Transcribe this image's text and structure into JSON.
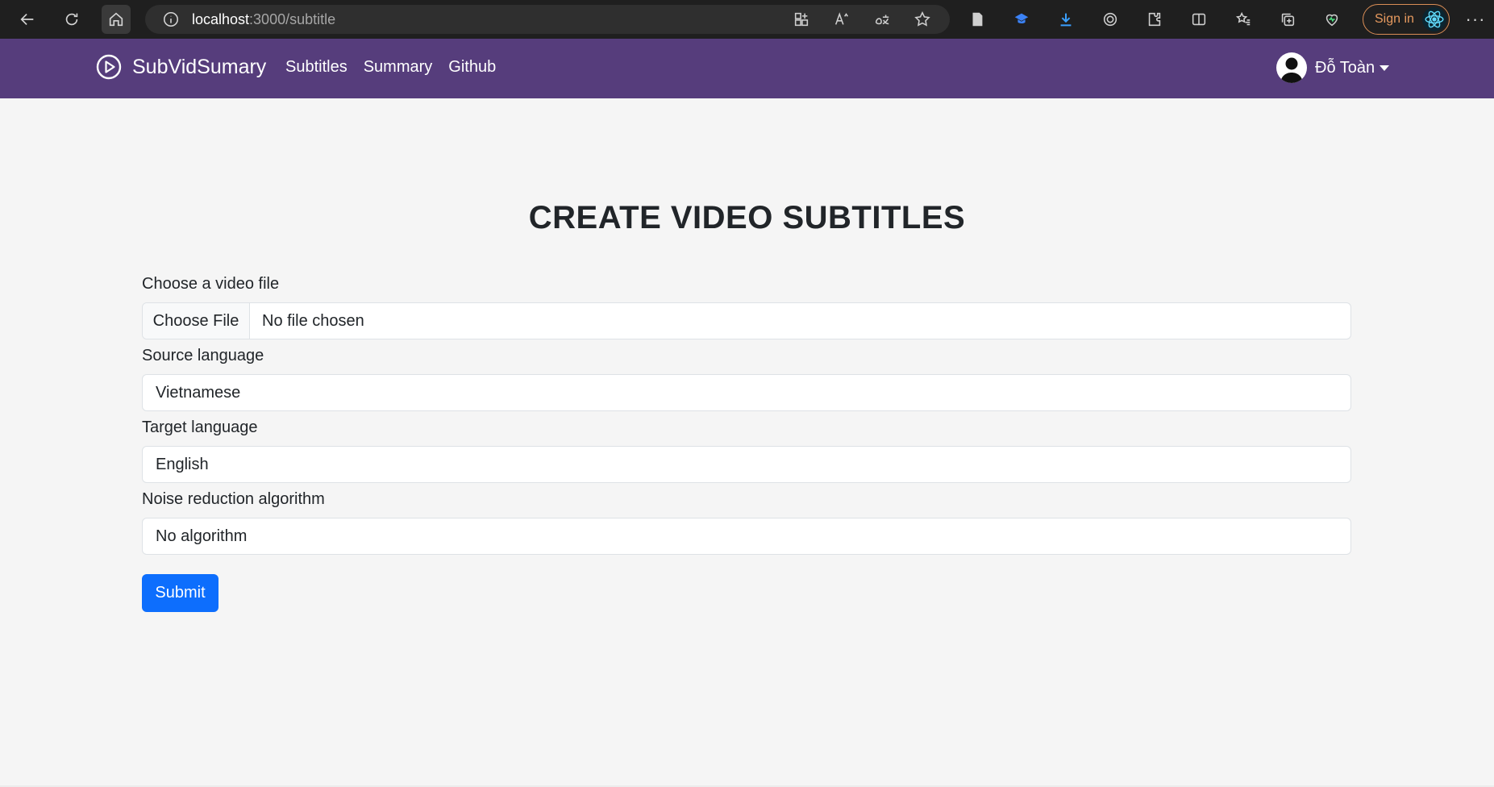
{
  "browser": {
    "url_host": "localhost",
    "url_path": ":3000/subtitle",
    "signin_label": "Sign in",
    "more_label": "···"
  },
  "navbar": {
    "brand": "SubVidSumary",
    "links": [
      "Subtitles",
      "Summary",
      "Github"
    ],
    "user_name": "Đỗ Toàn"
  },
  "page": {
    "title": "CREATE VIDEO SUBTITLES"
  },
  "form": {
    "video_label": "Choose a video file",
    "choose_file_button": "Choose File",
    "file_status": "No file chosen",
    "source_label": "Source language",
    "source_value": "Vietnamese",
    "target_label": "Target language",
    "target_value": "English",
    "noise_label": "Noise reduction algorithm",
    "noise_value": "No algorithm",
    "submit_label": "Submit"
  },
  "colors": {
    "navbar": "#563d7c",
    "submit": "#0d6efd",
    "signin_accent": "#e79a5f"
  }
}
